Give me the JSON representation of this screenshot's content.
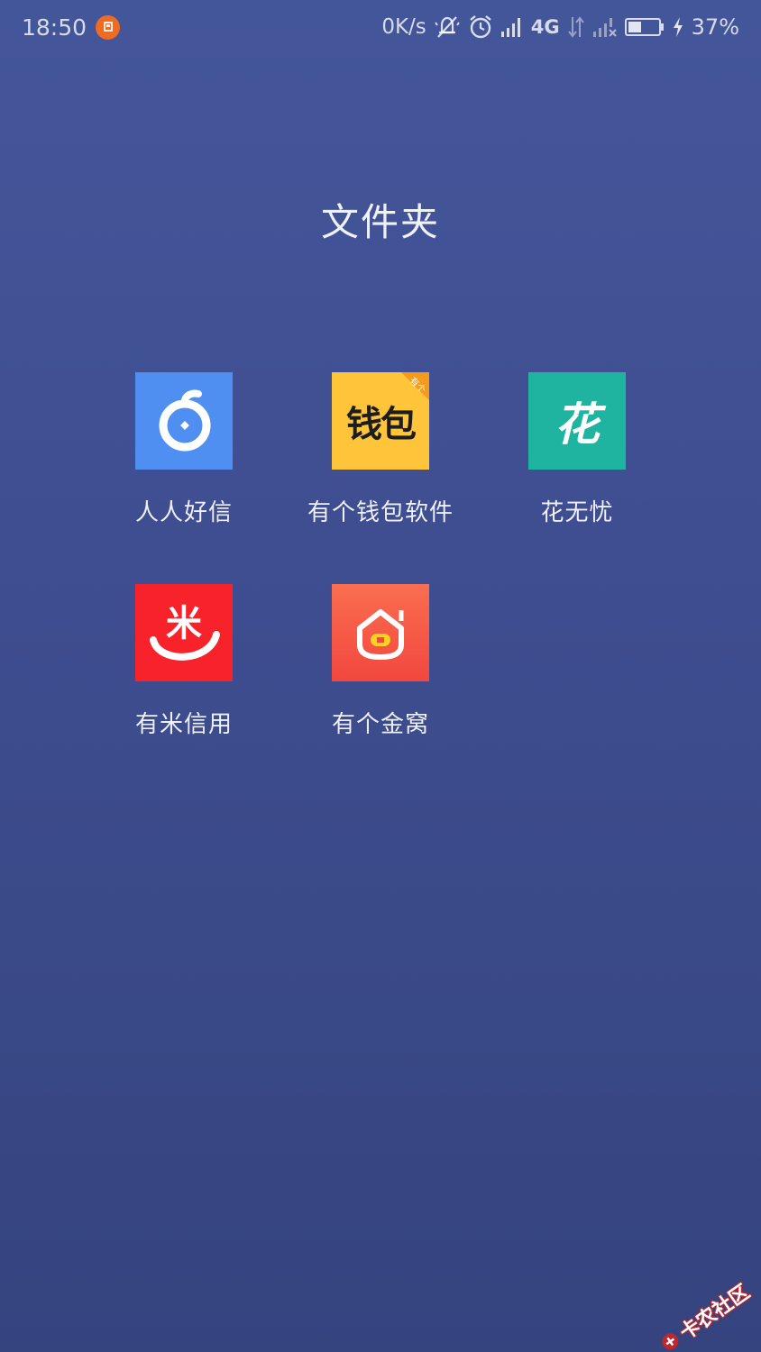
{
  "status_bar": {
    "time": "18:50",
    "net_speed": "0K/s",
    "network_type": "4G",
    "battery_percent": "37%",
    "icons": [
      "notification-badge-icon",
      "mute-bell-icon",
      "alarm-icon",
      "signal-icon",
      "data-arrows-icon",
      "signal-no-sim-icon",
      "battery-icon",
      "charging-icon"
    ]
  },
  "folder": {
    "title": "文件夹"
  },
  "apps": [
    {
      "label": "人人好信",
      "icon": "renren-haoxin-icon",
      "color": "#4f8ff2"
    },
    {
      "label": "有个钱包软件",
      "icon": "wallet-icon",
      "icon_text": "钱包",
      "corner_badge": "有个",
      "color": "#fec43a"
    },
    {
      "label": "花无忧",
      "icon": "hua-icon",
      "icon_text": "花",
      "color": "#1eb4a0"
    },
    {
      "label": "有米信用",
      "icon": "youmi-icon",
      "icon_text": "米",
      "color": "#f7222a"
    },
    {
      "label": "有个金窝",
      "icon": "gold-house-icon",
      "color": "#f85a43"
    }
  ],
  "watermark": {
    "text": "卡农社区"
  }
}
